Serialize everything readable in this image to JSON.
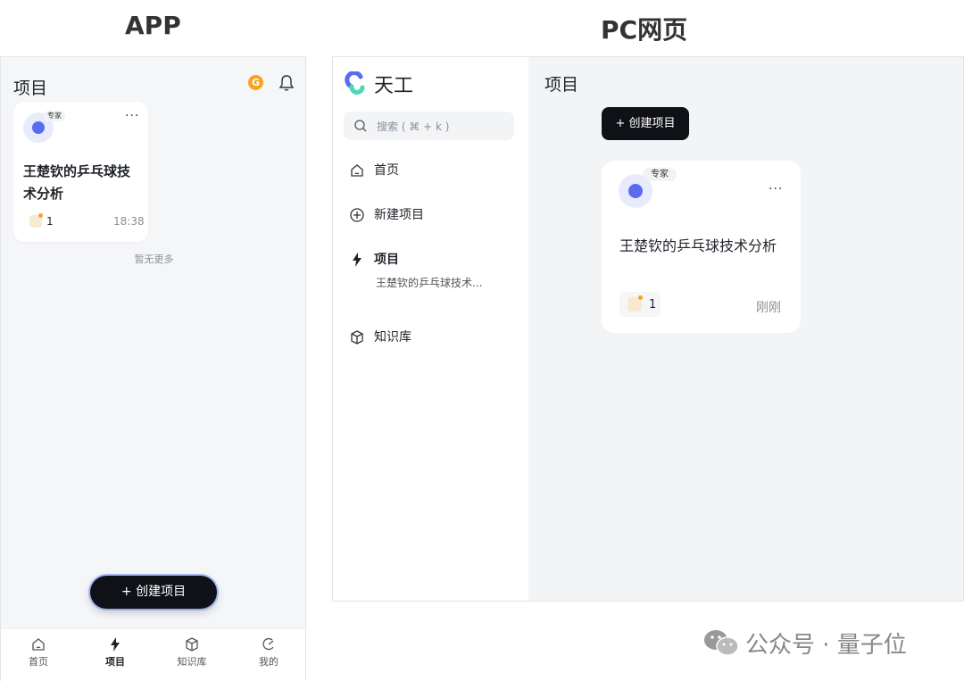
{
  "headings": {
    "app": "APP",
    "pc": "PC网页"
  },
  "app": {
    "title": "项目",
    "coin_icon_text": "G",
    "card": {
      "tag": "专家",
      "more": "···",
      "title": "王楚钦的乒乓球技术分析",
      "count": "1",
      "time": "18:38"
    },
    "no_more": "暂无更多",
    "create_button": "+ 创建项目",
    "tabs": [
      {
        "label": "首页",
        "icon": "home-icon"
      },
      {
        "label": "项目",
        "icon": "lightning-icon",
        "active": true
      },
      {
        "label": "知识库",
        "icon": "cube-icon"
      },
      {
        "label": "我的",
        "icon": "profile-icon"
      }
    ]
  },
  "pc": {
    "brand": "天工",
    "search_placeholder": "搜索 ( ⌘ + k )",
    "nav": [
      {
        "label": "首页",
        "icon": "home-icon"
      },
      {
        "label": "新建项目",
        "icon": "plus-circle-icon"
      },
      {
        "label": "项目",
        "icon": "lightning-icon",
        "sub": "王楚钦的乒乓球技术..."
      },
      {
        "label": "知识库",
        "icon": "cube-icon"
      }
    ],
    "main_title": "项目",
    "create_button": "+ 创建项目",
    "card": {
      "tag": "专家",
      "more": "···",
      "title": "王楚钦的乒乓球技术分析",
      "count": "1",
      "time": "刚刚"
    }
  },
  "watermark": "公众号 · 量子位",
  "colors": {
    "accent": "#5a6bf0",
    "dark_button": "#0f1117",
    "coin": "#f8a51c"
  }
}
